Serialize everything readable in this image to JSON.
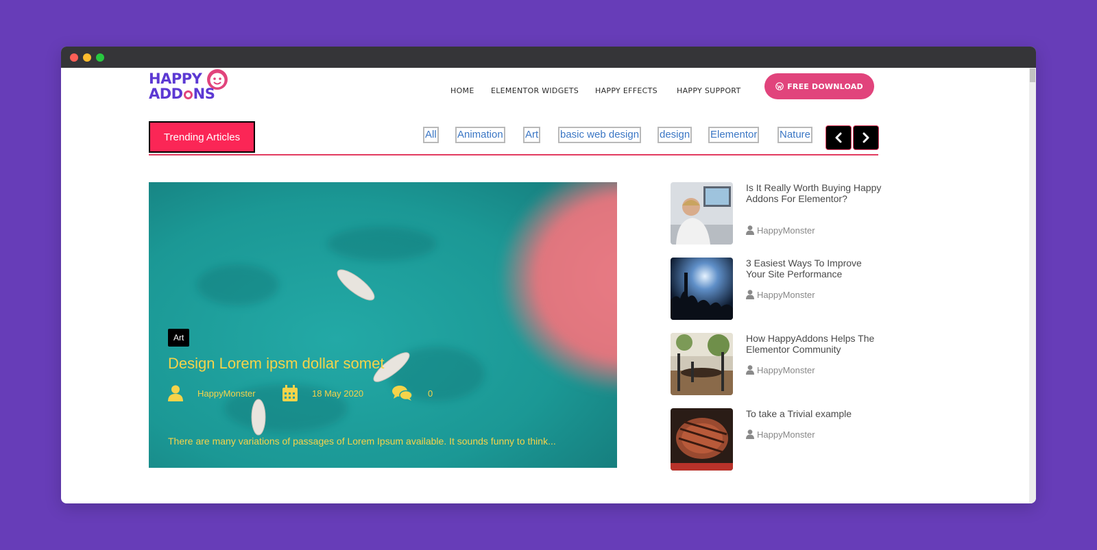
{
  "logo": {
    "line1": "HAPPY",
    "line2": "ADD",
    "line3": "NS"
  },
  "nav": {
    "items": [
      {
        "label": "HOME"
      },
      {
        "label": "ELEMENTOR WIDGETS"
      },
      {
        "label": "HAPPY EFFECTS"
      },
      {
        "label": "HAPPY SUPPORT"
      }
    ],
    "download_label": "FREE DOWNLOAD"
  },
  "trending": {
    "label": "Trending Articles",
    "filters": [
      "All",
      "Animation",
      "Art",
      "basic web design",
      "design",
      "Elementor",
      "Nature"
    ]
  },
  "featured": {
    "category": "Art",
    "title": "Design Lorem ipsm dollar somet",
    "author": "HappyMonster",
    "date": "18 May 2020",
    "comments": "0",
    "excerpt": "There are many variations of passages of Lorem Ipsum available. It sounds funny to think..."
  },
  "side_posts": [
    {
      "title": "Is It Really Worth Buying Happy Addons For Elementor?",
      "author": "HappyMonster"
    },
    {
      "title": "3 Easiest Ways To Improve Your Site Performance",
      "author": "HappyMonster"
    },
    {
      "title": "How HappyAddons Helps The Elementor Community",
      "author": "HappyMonster"
    },
    {
      "title": "To take a Trivial example",
      "author": "HappyMonster"
    }
  ],
  "colors": {
    "background": "#673db8",
    "accent_pink": "#e1447c",
    "trending_red": "#fb2656",
    "featured_text": "#f5d34a",
    "logo_purple": "#5c39d3"
  },
  "icons": {
    "download": "wordpress-icon",
    "prev": "chevron-left-icon",
    "next": "chevron-right-icon",
    "author": "user-icon",
    "date": "calendar-icon",
    "comments": "comments-icon"
  }
}
